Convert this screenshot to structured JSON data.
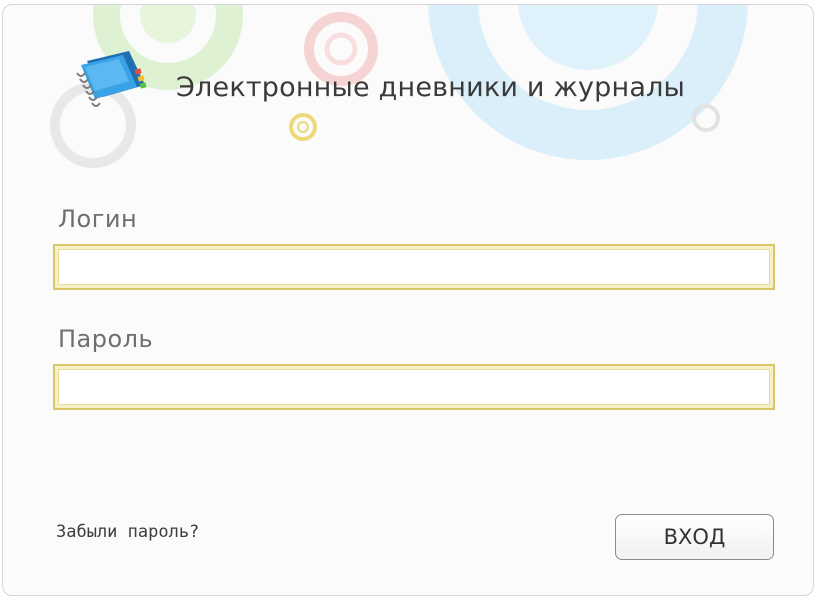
{
  "header": {
    "title": "Электронные дневники и журналы",
    "logo_icon": "notebook-icon"
  },
  "form": {
    "login_label": "Логин",
    "login_value": "",
    "password_label": "Пароль",
    "password_value": "",
    "forgot_link": "Забыли пароль?",
    "submit_label": "ВХОД"
  },
  "colors": {
    "field_border": "#d9c66a",
    "field_glow": "#f5f0c8",
    "title_text": "#3a3a3a",
    "label_text": "#6f6f6f",
    "decor_green": "#c9e9b8",
    "decor_blue": "#c9e7f5",
    "decor_pink": "#f4cccc",
    "logo_blue": "#2f8fd6"
  }
}
